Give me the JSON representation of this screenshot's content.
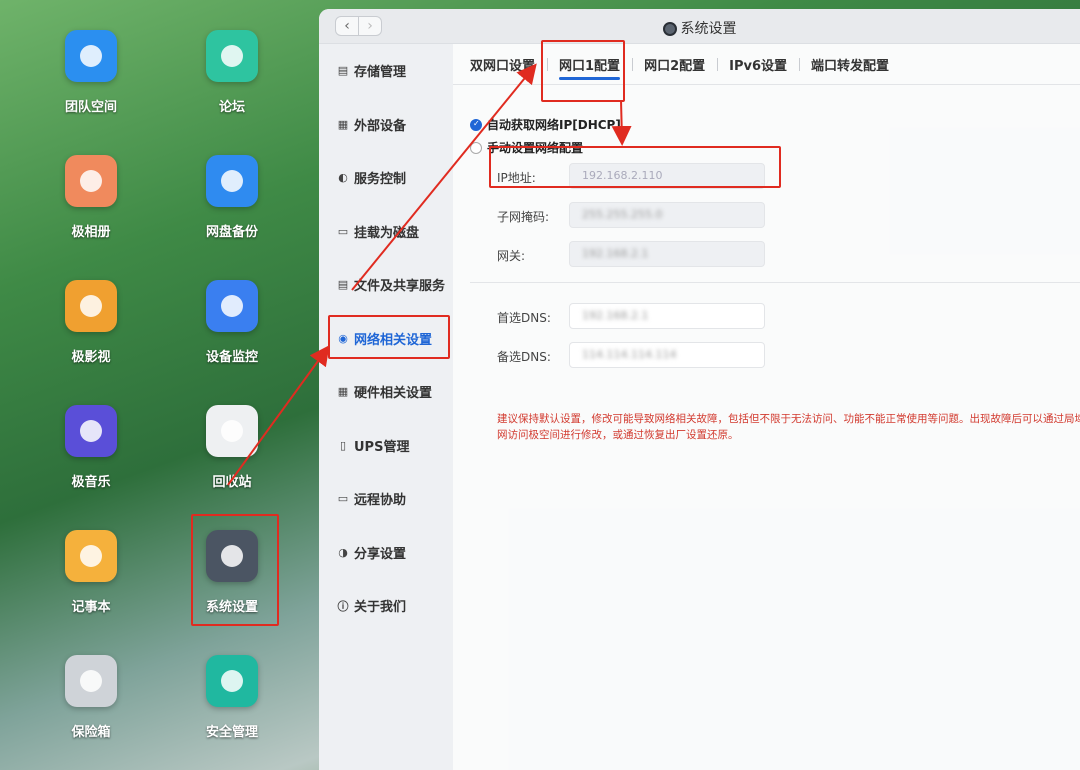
{
  "desktop": {
    "icons": [
      {
        "label": "团队空间",
        "icon": "team-folder-icon",
        "color": "#2b8ff0"
      },
      {
        "label": "论坛",
        "icon": "forum-chat-icon",
        "color": "#2ec4a0"
      },
      {
        "label": "极相册",
        "icon": "photo-album-icon",
        "color": "#f08a5d"
      },
      {
        "label": "网盘备份",
        "icon": "cloud-backup-icon",
        "color": "#2f8bf0"
      },
      {
        "label": "极影视",
        "icon": "video-icon",
        "color": "#f0a030"
      },
      {
        "label": "设备监控",
        "icon": "device-monitor-icon",
        "color": "#3a7ff0"
      },
      {
        "label": "极音乐",
        "icon": "music-icon",
        "color": "#5a4fd8"
      },
      {
        "label": "回收站",
        "icon": "trash-icon",
        "color": "#eef0f2"
      },
      {
        "label": "记事本",
        "icon": "notepad-icon",
        "color": "#f5b13c"
      },
      {
        "label": "系统设置",
        "icon": "system-settings-icon",
        "color": "#4b5563"
      },
      {
        "label": "保险箱",
        "icon": "safe-box-icon",
        "color": "#cfd3d8"
      },
      {
        "label": "安全管理",
        "icon": "security-shield-icon",
        "color": "#20b8a0"
      }
    ]
  },
  "window": {
    "title": "系统设置",
    "back": "‹",
    "forward": "›",
    "sidebar": [
      {
        "label": "存储管理",
        "icon": "storage-icon",
        "glyph": "▤"
      },
      {
        "label": "外部设备",
        "icon": "external-device-icon",
        "glyph": "▦"
      },
      {
        "label": "服务控制",
        "icon": "service-toggle-icon",
        "glyph": "◐"
      },
      {
        "label": "挂载为磁盘",
        "icon": "mount-disk-icon",
        "glyph": "▭"
      },
      {
        "label": "文件及共享服务",
        "icon": "file-share-icon",
        "glyph": "▤"
      },
      {
        "label": "网络相关设置",
        "icon": "network-globe-icon",
        "glyph": "◉"
      },
      {
        "label": "硬件相关设置",
        "icon": "hardware-grid-icon",
        "glyph": "▦"
      },
      {
        "label": "UPS管理",
        "icon": "ups-icon",
        "glyph": "▯"
      },
      {
        "label": "远程协助",
        "icon": "remote-assist-icon",
        "glyph": "▭"
      },
      {
        "label": "分享设置",
        "icon": "share-icon",
        "glyph": "◑"
      },
      {
        "label": "关于我们",
        "icon": "info-icon",
        "glyph": "ⓘ"
      }
    ],
    "tabs": [
      "双网口设置",
      "网口1配置",
      "网口2配置",
      "IPv6设置",
      "端口转发配置"
    ],
    "form": {
      "auto_label": "自动获取网络IP[DHCP]",
      "manual_label": "手动设置网络配置",
      "ip_label": "IP地址:",
      "ip_value": "192.168.2.110",
      "mask_label": "子网掩码:",
      "mask_value": "255.255.255.0",
      "gateway_label": "网关:",
      "gateway_value": "192.168.2.1",
      "dns1_label": "首选DNS:",
      "dns1_value": "192.168.2.1",
      "dns2_label": "备选DNS:",
      "dns2_value": "114.114.114.114",
      "warning": "建议保持默认设置，修改可能导致网络相关故障，包括但不限于无法访问、功能不能正常使用等问题。出现故障后可以通过局域网访问极空间进行修改，或通过恢复出厂设置还原。"
    }
  },
  "colors": {
    "accent": "#1f66d6",
    "annotation": "#e02b20",
    "warning": "#d23a2f"
  }
}
